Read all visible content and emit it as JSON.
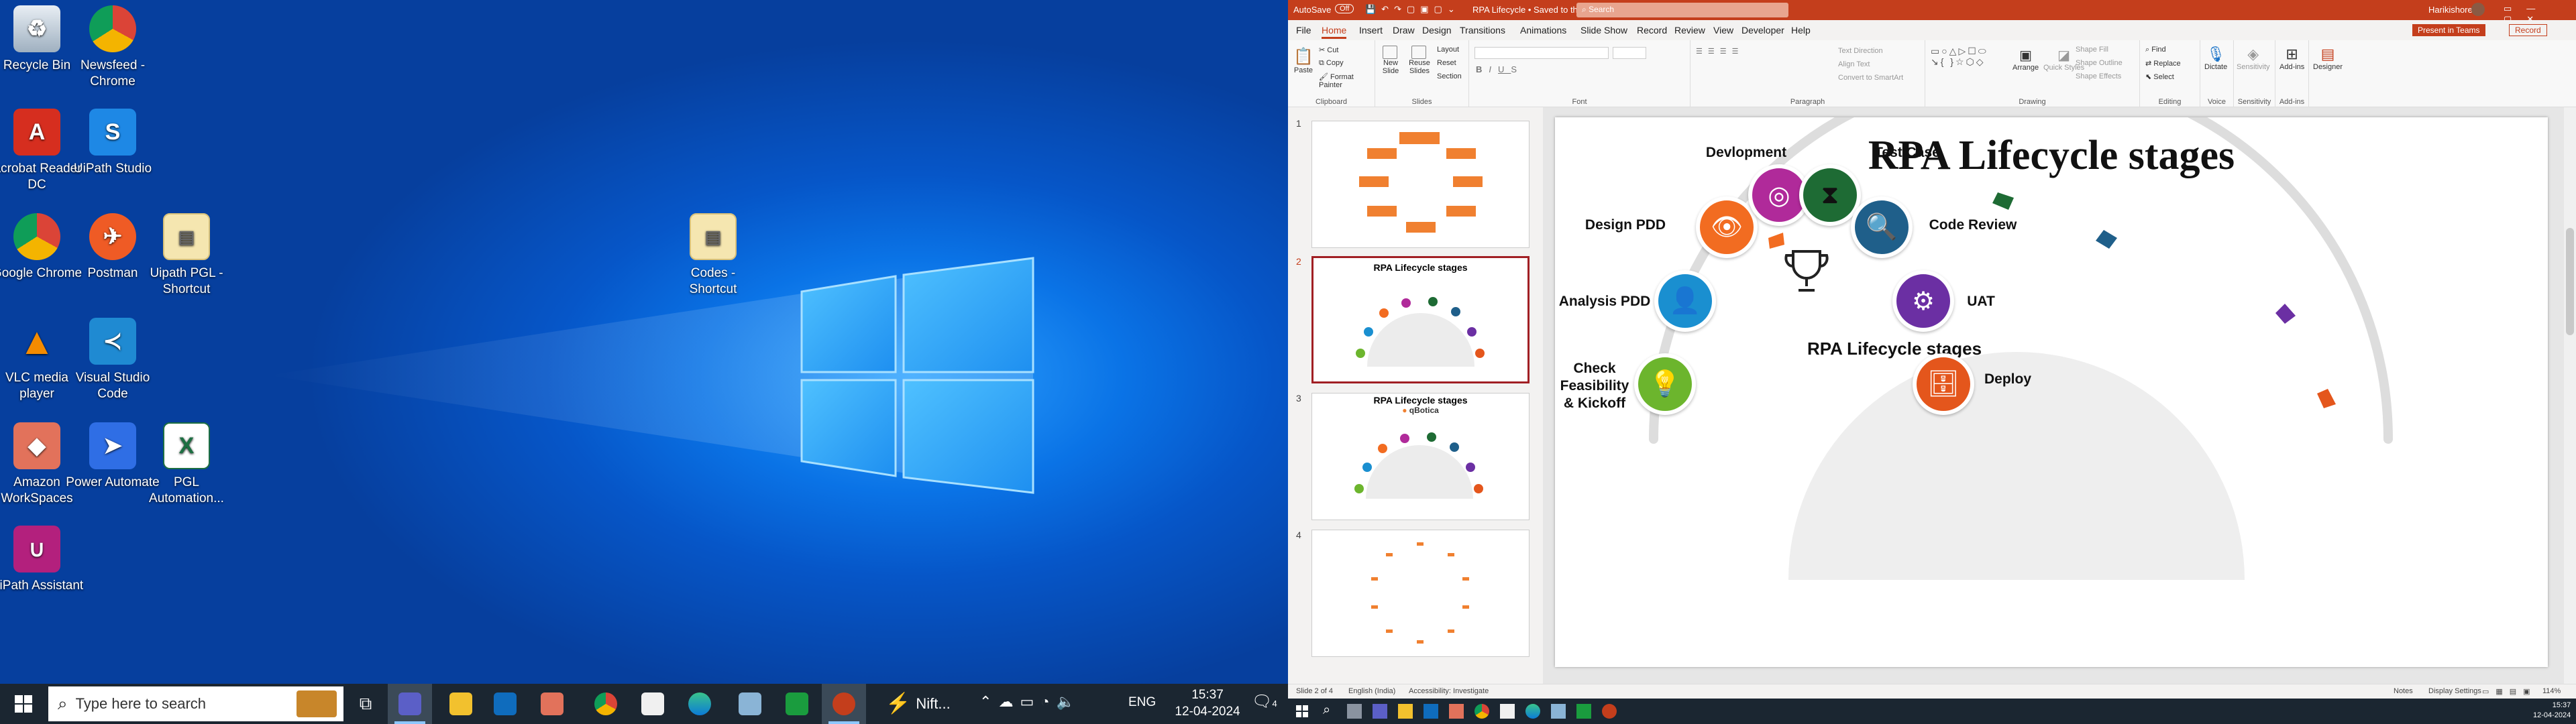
{
  "desktop": {
    "icons": [
      {
        "label": "Recycle Bin",
        "icon": "recycle-bin-icon"
      },
      {
        "label": "Newsfeed - Chrome",
        "icon": "chrome-icon"
      },
      {
        "label": "Acrobat Reader DC",
        "icon": "acrobat-icon"
      },
      {
        "label": "UiPath Studio",
        "icon": "uipath-icon"
      },
      {
        "label": "Google Chrome",
        "icon": "chrome-icon"
      },
      {
        "label": "Postman",
        "icon": "postman-icon"
      },
      {
        "label": "Uipath PGL - Shortcut",
        "icon": "file-shortcut-icon"
      },
      {
        "label": "VLC media player",
        "icon": "vlc-icon"
      },
      {
        "label": "Visual Studio Code",
        "icon": "vscode-icon"
      },
      {
        "label": "Amazon WorkSpaces",
        "icon": "workspaces-icon"
      },
      {
        "label": "Power Automate",
        "icon": "power-automate-icon"
      },
      {
        "label": "PGL Automation...",
        "icon": "excel-icon"
      },
      {
        "label": "UiPath Assistant",
        "icon": "uipath-assistant-icon"
      },
      {
        "label": "Codes - Shortcut",
        "icon": "file-shortcut-icon"
      }
    ]
  },
  "taskbar_left": {
    "search_placeholder": "Type here to search",
    "weather": "Nift...",
    "language": "ENG",
    "time": "15:37",
    "date": "12-04-2024",
    "notification_count": "4"
  },
  "ppt": {
    "autosave": "AutoSave",
    "autosave_state": "Off",
    "doc_title": "RPA Lifecycle • Saved to this PC",
    "search": "Search",
    "user": "Harikishore S",
    "menu": [
      "File",
      "Home",
      "Insert",
      "Draw",
      "Design",
      "Transitions",
      "Animations",
      "Slide Show",
      "Record",
      "Review",
      "View",
      "Developer",
      "Help"
    ],
    "record_btn": "Record",
    "present_btn": "Present in Teams",
    "ribbon": {
      "clipboard": {
        "paste": "Paste",
        "cut": "Cut",
        "copy": "Copy",
        "format_painter": "Format Painter",
        "label": "Clipboard"
      },
      "slides": {
        "new_slide": "New Slide",
        "reuse": "Reuse Slides",
        "layout": "Layout",
        "reset": "Reset",
        "section": "Section",
        "label": "Slides"
      },
      "font": {
        "label": "Font"
      },
      "paragraph": {
        "text_direction": "Text Direction",
        "align_text": "Align Text",
        "smartart": "Convert to SmartArt",
        "label": "Paragraph"
      },
      "drawing": {
        "arrange": "Arrange",
        "quick_styles": "Quick Styles",
        "shape_fill": "Shape Fill",
        "shape_outline": "Shape Outline",
        "shape_effects": "Shape Effects",
        "label": "Drawing"
      },
      "editing": {
        "find": "Find",
        "replace": "Replace",
        "select": "Select",
        "label": "Editing"
      },
      "voice": {
        "dictate": "Dictate",
        "label": "Voice"
      },
      "sensitivity": {
        "btn": "Sensitivity",
        "label": "Sensitivity"
      },
      "addins": {
        "btn": "Add-ins",
        "label": "Add-ins"
      },
      "designer": {
        "btn": "Designer"
      }
    },
    "thumbnails": [
      {
        "num": "1",
        "title": ""
      },
      {
        "num": "2",
        "title": "RPA Lifecycle stages"
      },
      {
        "num": "3",
        "title": "RPA Lifecycle stages",
        "subtitle": "qBotica"
      },
      {
        "num": "4",
        "title": ""
      }
    ],
    "slide": {
      "title": "RPA Lifecycle stages",
      "center_label": "RPA Lifecycle stages",
      "stages": [
        {
          "label": "Check Feasibility & Kickoff",
          "color": "#6cb52d",
          "icon": "lightbulb-icon"
        },
        {
          "label": "Analysis PDD",
          "color": "#1a8fd0",
          "icon": "head-icon"
        },
        {
          "label": "Design PDD",
          "color": "#f26c21",
          "icon": "eye-icon"
        },
        {
          "label": "Devlopment",
          "color": "#b02a9a",
          "icon": "target-icon"
        },
        {
          "label": "Test Case",
          "color": "#1e6b34",
          "icon": "hourglass-icon"
        },
        {
          "label": "Code Review",
          "color": "#1f5f8a",
          "icon": "magnifier-icon"
        },
        {
          "label": "UAT",
          "color": "#6b2fa3",
          "icon": "gears-icon"
        },
        {
          "label": "Deploy",
          "color": "#e4561c",
          "icon": "database-icon"
        }
      ]
    },
    "status": {
      "slide_of": "Slide 2 of 4",
      "language": "English (India)",
      "accessibility": "Accessibility: Investigate",
      "notes": "Notes",
      "display": "Display Settings",
      "zoom": "114%"
    },
    "taskbar_time": "15:37",
    "taskbar_date": "12-04-2024"
  }
}
